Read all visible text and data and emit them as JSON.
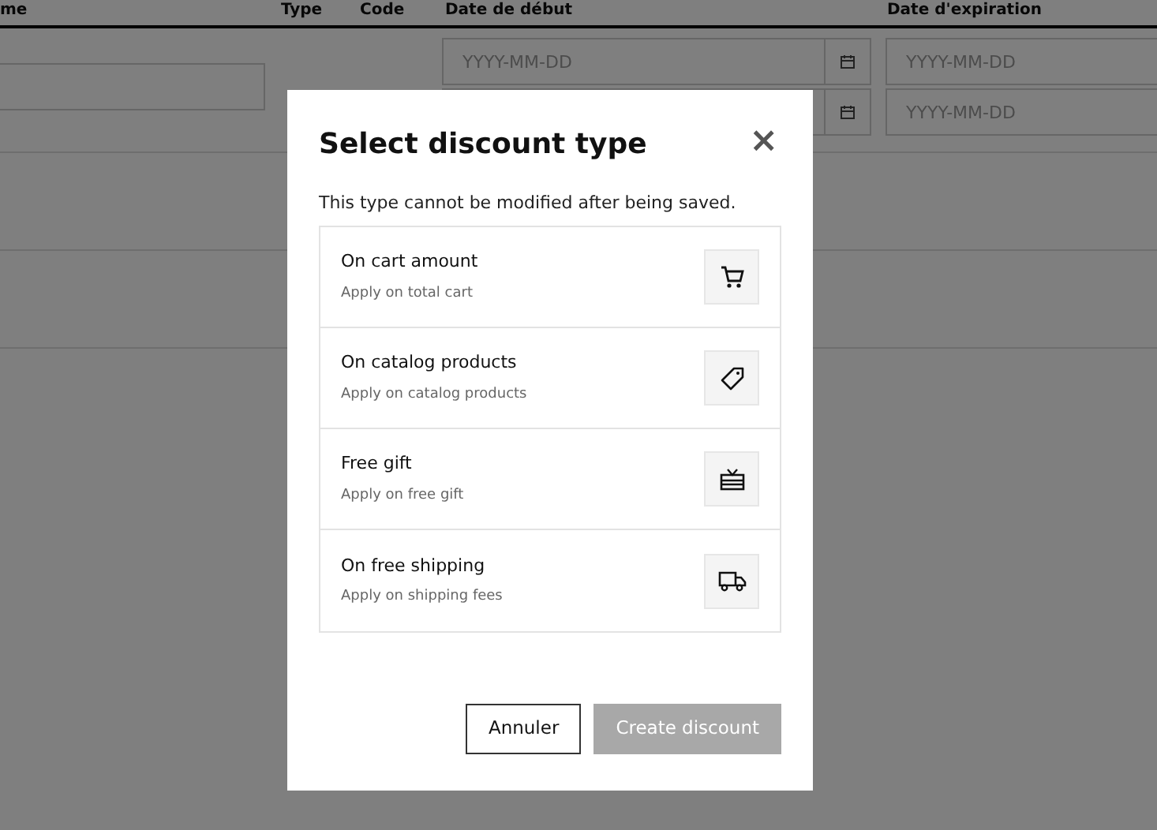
{
  "table": {
    "columns": [
      "me",
      "Type",
      "Code",
      "Date de début",
      "Date d'expiration"
    ],
    "rows": [
      {
        "start_placeholder": "YYYY-MM-DD",
        "end_placeholder": "YYYY-MM-DD"
      },
      {
        "end_placeholder": "YYYY-MM-DD"
      }
    ]
  },
  "modal": {
    "title": "Select discount type",
    "close": "×",
    "description": "This type cannot be modified after being saved.",
    "options": [
      {
        "title": "On cart amount",
        "subtitle": "Apply on total cart",
        "kind": "cart"
      },
      {
        "title": "On catalog products",
        "subtitle": "Apply on catalog products",
        "kind": "tag"
      },
      {
        "title": "Free gift",
        "subtitle": "Apply on free gift",
        "kind": "gift"
      },
      {
        "title": "On free shipping",
        "subtitle": "Apply on shipping fees",
        "kind": "truck"
      }
    ],
    "buttons": [
      {
        "label": "Annuler",
        "kind": "secondary",
        "disabled": false
      },
      {
        "label": "Create discount",
        "kind": "primary",
        "disabled": true
      }
    ]
  }
}
